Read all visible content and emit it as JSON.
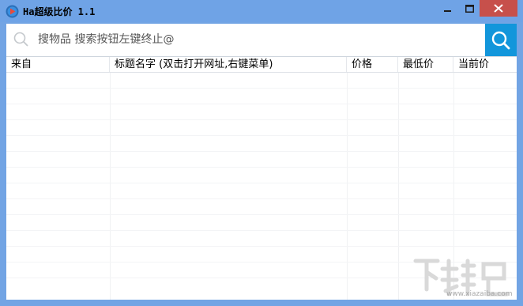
{
  "window": {
    "title": "Ha超级比价 1.1"
  },
  "search": {
    "placeholder": "搜物品 搜索按钮左键终止@"
  },
  "table": {
    "columns": [
      "来自",
      "标题名字 (双击打开网址,右键菜单)",
      "价格",
      "最低价",
      "当前价"
    ],
    "rows": []
  },
  "watermark": {
    "logo_text": "下载吧",
    "url": "www.xiazaiba.com"
  },
  "colors": {
    "titlebar": "#6fa3e6",
    "close_button": "#c7504b",
    "search_button": "#1296db"
  },
  "icons": {
    "app": "app-logo-icon",
    "search_left": "search-icon",
    "search_button": "search-icon",
    "minimize": "minimize-icon",
    "maximize": "maximize-icon",
    "close": "close-icon"
  }
}
